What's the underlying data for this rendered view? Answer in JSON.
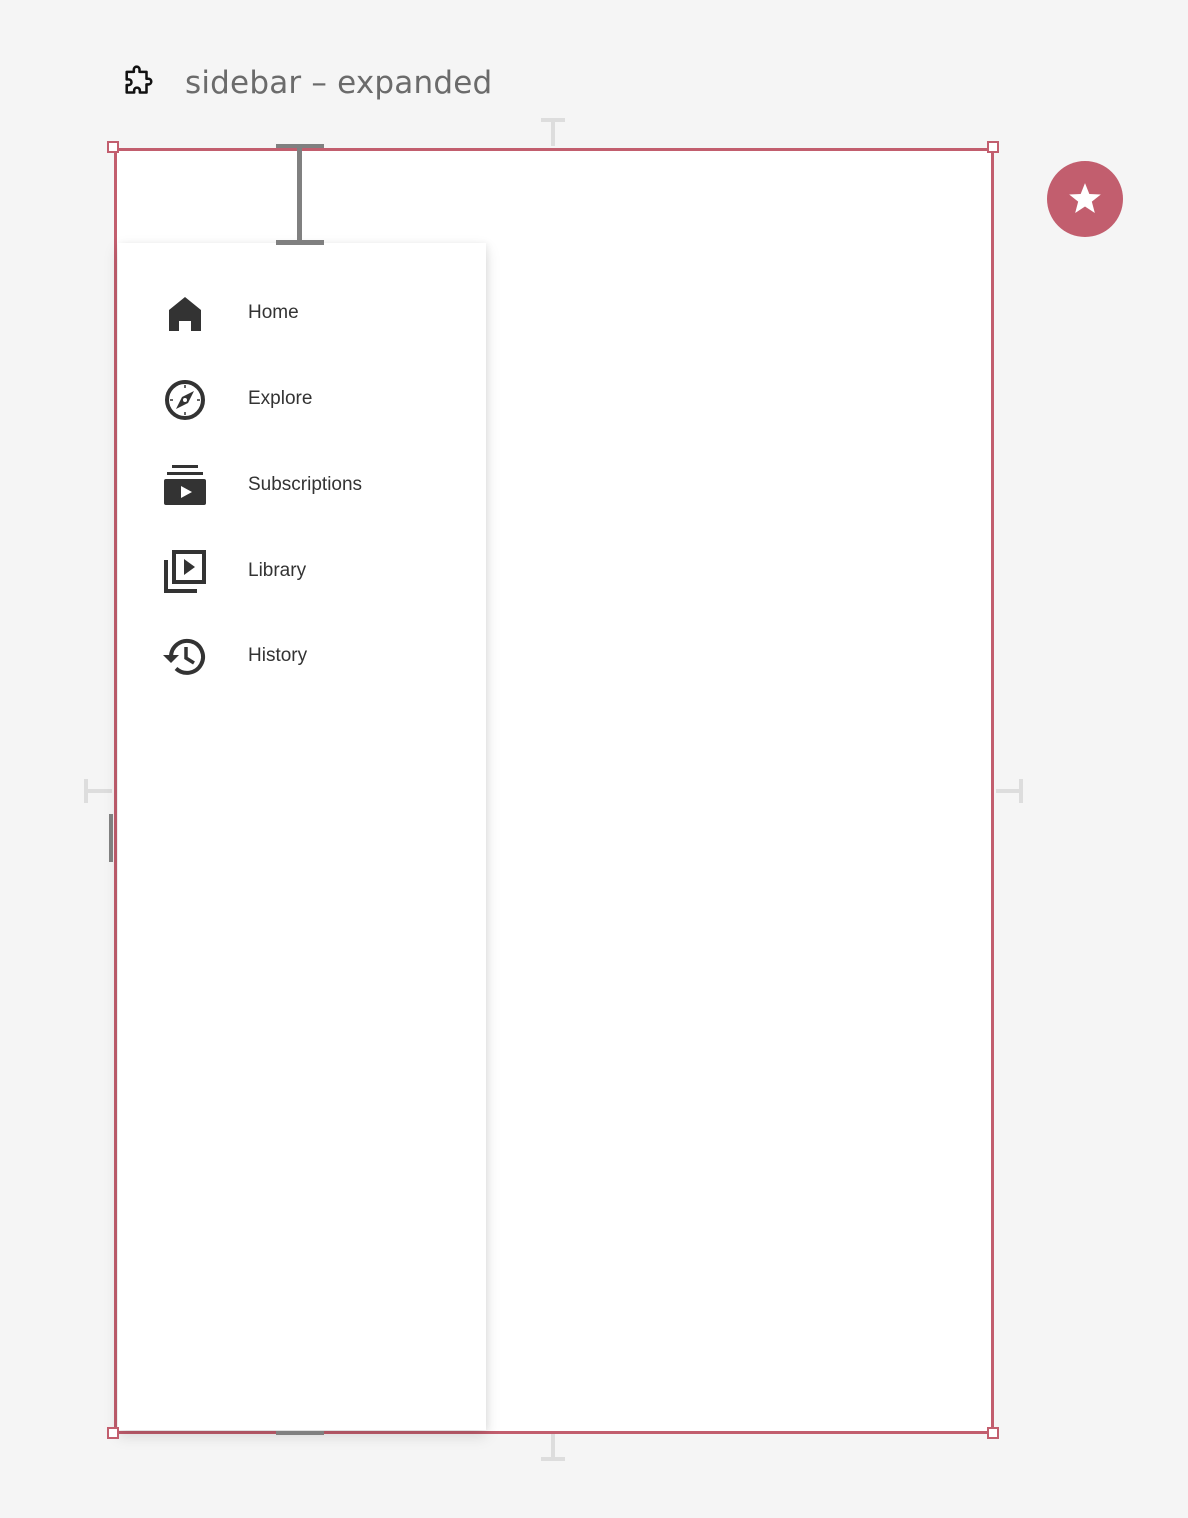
{
  "header": {
    "icon": "puzzle-icon",
    "title": "sidebar – expanded"
  },
  "sidebar": {
    "items": [
      {
        "label": "Home",
        "icon": "home-icon"
      },
      {
        "label": "Explore",
        "icon": "compass-icon"
      },
      {
        "label": "Subscriptions",
        "icon": "subscriptions-icon"
      },
      {
        "label": "Library",
        "icon": "video-library-icon"
      },
      {
        "label": "History",
        "icon": "history-icon"
      }
    ]
  },
  "fab": {
    "icon": "star-icon"
  },
  "colors": {
    "accent": "#c25e6e",
    "background": "#f5f5f5",
    "text": "#333333",
    "title": "#6b6b6b"
  }
}
